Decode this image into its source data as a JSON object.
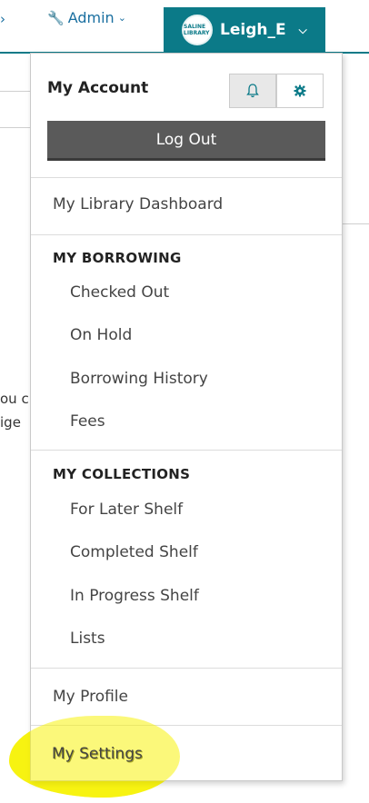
{
  "topbar": {
    "admin_label": "Admin",
    "user_label": "Leigh_E",
    "avatar_text": "SALINE LIBRARY"
  },
  "background": {
    "snippet_1": "ou c",
    "snippet_2": "ige"
  },
  "menu": {
    "account_title": "My Account",
    "logout_label": "Log Out",
    "dashboard": "My Library Dashboard",
    "borrowing_heading": "MY BORROWING",
    "borrowing_items": [
      "Checked Out",
      "On Hold",
      "Borrowing History",
      "Fees"
    ],
    "collections_heading": "MY COLLECTIONS",
    "collections_items": [
      "For Later Shelf",
      "Completed Shelf",
      "In Progress Shelf",
      "Lists"
    ],
    "profile": "My Profile",
    "settings": "My Settings"
  },
  "colors": {
    "teal": "#0b7a88",
    "link_blue": "#1a6fa0",
    "highlight": "#f7f20c",
    "logout_bg": "#5a5a5a"
  }
}
